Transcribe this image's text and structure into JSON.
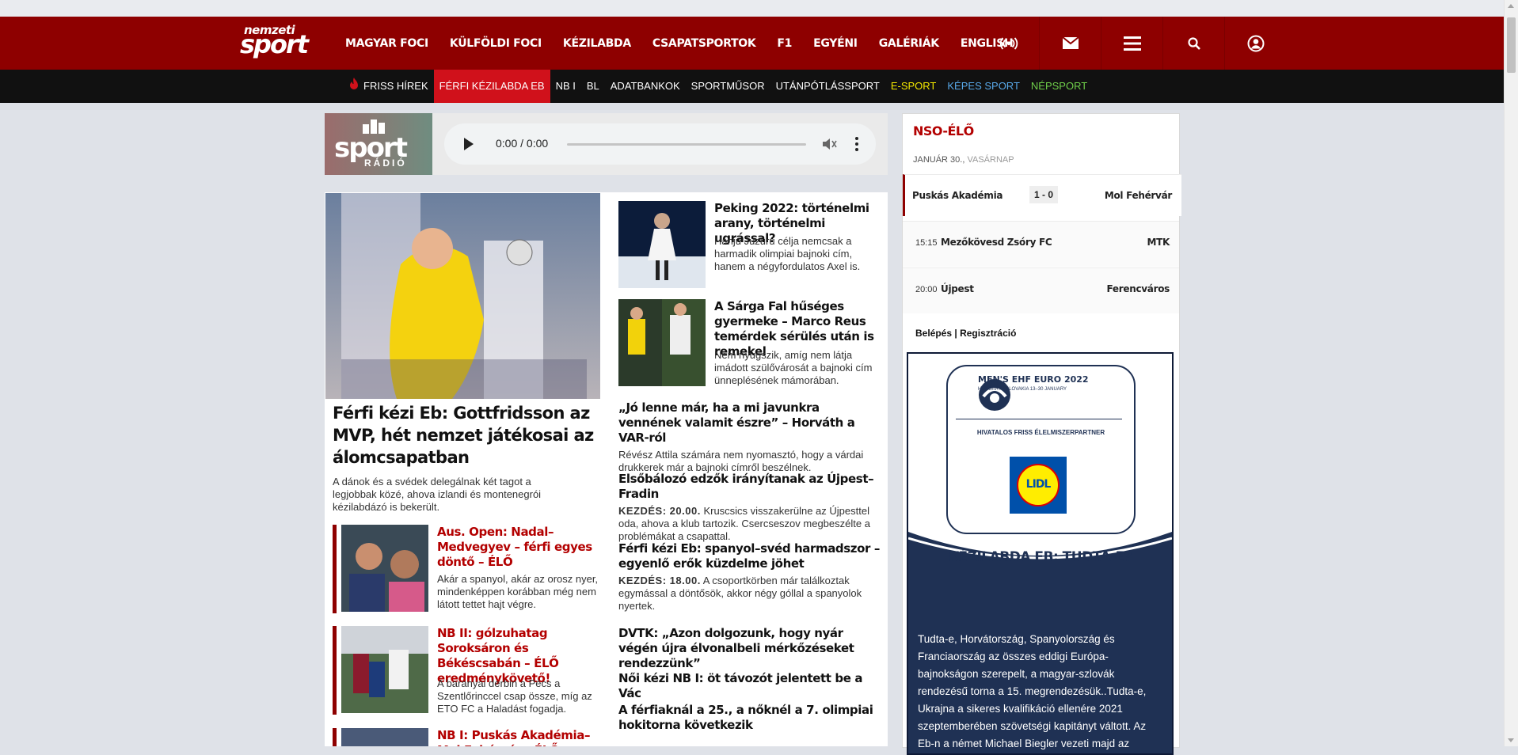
{
  "logo": {
    "line1": "nemzeti",
    "line2": "sport"
  },
  "mainnav": {
    "items": [
      "MAGYAR FOCI",
      "KÜLFÖLDI FOCI",
      "KÉZILABDA",
      "CSAPATSPORTOK",
      "F1",
      "EGYÉNI",
      "GALÉRIÁK",
      "ENGLISH"
    ],
    "icons": [
      "radio-icon",
      "mail-icon",
      "menu-icon",
      "search-icon",
      "user-icon"
    ]
  },
  "subnav": {
    "items": [
      {
        "label": "FRISS HÍREK",
        "color": "#ffffff"
      },
      {
        "label": "FÉRFI KÉZILABDA EB",
        "color": "#ffffff",
        "active": true
      },
      {
        "label": "NB I",
        "color": "#ffffff"
      },
      {
        "label": "BL",
        "color": "#ffffff"
      },
      {
        "label": "ADATBANKOK",
        "color": "#ffffff"
      },
      {
        "label": "SPORTMŰSOR",
        "color": "#ffffff"
      },
      {
        "label": "UTÁNPÓTLÁSSPORT",
        "color": "#ffffff"
      },
      {
        "label": "E-SPORT",
        "color": "#f2e600"
      },
      {
        "label": "KÉPES SPORT",
        "color": "#58a8e8"
      },
      {
        "label": "NÉPSPORT",
        "color": "#6fce4a"
      }
    ]
  },
  "radio": {
    "logo_top": "sport",
    "logo_bottom": "RÁDIÓ",
    "time": "0:00 / 0:00"
  },
  "lead": {
    "title": "Férfi kézi Eb: Gottfridsson az MVP, hét nemzet játékosai az álomcsapatban",
    "desc": "A dánok és a svédek delegálnak két tagot a legjobbak közé, ahova izlandi és montenegrói kézilabdázó is bekerült."
  },
  "redcards": [
    {
      "title": "Aus. Open: Nadal–Medvegyev – férfi egyes döntő – ÉLŐ",
      "desc": "Akár a spanyol, akár az orosz nyer, mindenképpen korábban még nem látott tettet hajt végre."
    },
    {
      "title": "NB II: gólzuhatag Soroksáron és Békéscsabán – ÉLŐ eredménykövető!",
      "desc": "A baranyai derbin a Pécs a Szentlőrinccel csap össze, míg az ETO FC a Haladást fogadja."
    },
    {
      "title": "NB I: Puskás Akadémia–Mol Fehérvár – ÉLŐ",
      "desc": ""
    }
  ],
  "stories": [
    {
      "title": "Peking 2022: történelmi arany, történelmi ugrással?",
      "desc": "Hanju Juzuru célja nemcsak a harmadik olimpiai bajnoki cím, hanem a négyfordulatos Axel is."
    },
    {
      "title": "A Sárga Fal hűséges gyermeke – Marco Reus temérdek sérülés után is remekel",
      "desc": "Nem nyugszik, amíg nem látja imádott szülővárosát a bajnoki cím ünneplésének mámorában."
    }
  ],
  "textstories": [
    {
      "title": "„Jó lenne már, ha a mi javunkra vennének valamit észre” – Horváth a VAR-ról",
      "kicker": "",
      "desc": "Révész Attila számára nem nyomasztó, hogy a várdai drukkerek már a bajnoki címről beszélnek."
    },
    {
      "title": "Elsőbálozó edzők irányítanak az Újpest–Fradin",
      "kicker": "KEZDÉS: 20.00.",
      "desc": " Kruscsics visszakerülne az Újpesttel oda, ahova a klub tartozik. Csercseszov megbeszélte a problémákat a csapattal."
    },
    {
      "title": "Férfi kézi Eb: spanyol–svéd harmadszor – egyenlő erők küzdelme jöhet",
      "kicker": "KEZDÉS: 18.00.",
      "desc": " A csoportkörben már találkoztak egymással a döntősök, akkor négy góllal a spanyolok nyertek."
    },
    {
      "title": "DVTK: „Azon dolgozunk, hogy nyár végén újra élvonalbeli mérkőzéseket rendezzünk”",
      "kicker": "",
      "desc": ""
    },
    {
      "title": "Női kézi NB I: öt távozót jelentett be a Vác",
      "kicker": "",
      "desc": ""
    },
    {
      "title": "A férfiaknál a 25., a nőknél a 7. olimpiai hokitorna következik",
      "kicker": "",
      "desc": ""
    }
  ],
  "sidebar": {
    "title": "NSO-ÉLŐ",
    "date_main": "JANUÁR 30.,",
    "date_day": " VASÁRNAP",
    "matches": [
      {
        "time": "",
        "home": "Puskás Akadémia",
        "score": "1 - 0",
        "away": "Mol Fehérvár",
        "live": true
      },
      {
        "time": "15:15",
        "home": "Mezőkövesd Zsóry FC",
        "score": "",
        "away": "MTK",
        "live": false
      },
      {
        "time": "20:00",
        "home": "Újpest",
        "score": "",
        "away": "Ferencváros",
        "live": false
      }
    ],
    "login": "Belépés",
    "register": "Regisztráció"
  },
  "ad": {
    "ehf_title": "MEN'S EHF EURO 2022",
    "ehf_sub": "HUNGARY • SLOVAKIA 13–30 JANUARY",
    "partner": "HIVATALOS FRISS ÉLELMISZERPARTNER",
    "brand": "LIDL",
    "heading": "KÉZILABDA EB: TUDTA-E?",
    "text": "Tudta-e, Horvátország, Spanyolország és Franciaország az összes eddigi Európa-bajnokságon szerepelt, a magyar-szlovák rendezésű torna a 15. megrendezésük..Tudta-e, Ukrajna a sikeres kvalifikáció ellenére 2021 szeptemberében szövetségi kapitányt váltott. Az Eb-n a német Michael Biegler vezeti majd az"
  }
}
